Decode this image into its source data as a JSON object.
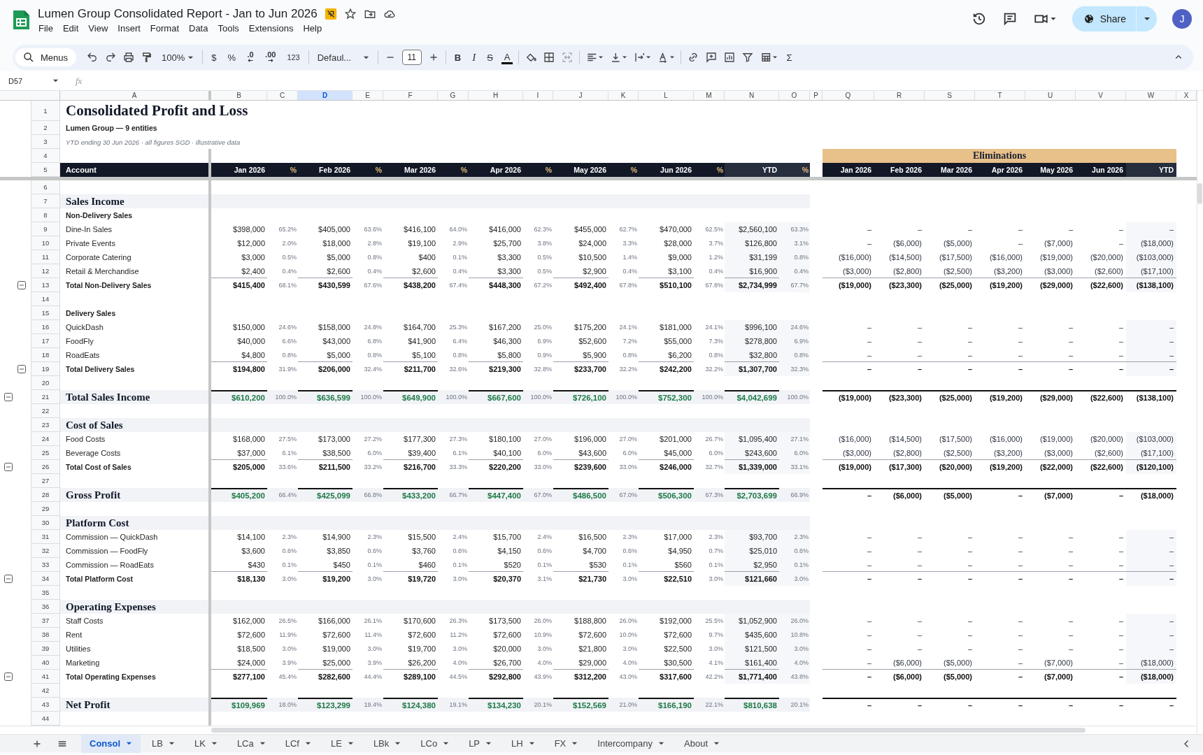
{
  "document": {
    "title": "Lumen Group Consolidated Report - Jan to Jun 2026",
    "menus": [
      "File",
      "Edit",
      "View",
      "Insert",
      "Format",
      "Data",
      "Tools",
      "Extensions",
      "Help"
    ],
    "share": "Share",
    "avatar": "J"
  },
  "toolbar": {
    "menus": "Menus",
    "zoom": "100%",
    "currency": "$",
    "percent": "%",
    "dec_less": ".0",
    "dec_more": ".00",
    "number_format": "123",
    "font": "Defaul...",
    "font_size": "11",
    "bold": "B",
    "italic": "I",
    "strikethrough": "S",
    "text_color": "A",
    "sum": "Σ"
  },
  "formula_bar": {
    "cell": "D57",
    "fx": "fx"
  },
  "columns": [
    {
      "letter": "A",
      "selected": false
    },
    {
      "letter": "B",
      "selected": false
    },
    {
      "letter": "C",
      "selected": false
    },
    {
      "letter": "D",
      "selected": true
    },
    {
      "letter": "E",
      "selected": false
    },
    {
      "letter": "F",
      "selected": false
    },
    {
      "letter": "G",
      "selected": false
    },
    {
      "letter": "H",
      "selected": false
    },
    {
      "letter": "I",
      "selected": false
    },
    {
      "letter": "J",
      "selected": false
    },
    {
      "letter": "K",
      "selected": false
    },
    {
      "letter": "L",
      "selected": false
    },
    {
      "letter": "M",
      "selected": false
    },
    {
      "letter": "N",
      "selected": false
    },
    {
      "letter": "O",
      "selected": false
    },
    {
      "letter": "P",
      "selected": false
    },
    {
      "letter": "Q",
      "selected": false
    },
    {
      "letter": "R",
      "selected": false
    },
    {
      "letter": "S",
      "selected": false
    },
    {
      "letter": "T",
      "selected": false
    },
    {
      "letter": "U",
      "selected": false
    },
    {
      "letter": "V",
      "selected": false
    },
    {
      "letter": "W",
      "selected": false
    },
    {
      "letter": "X",
      "selected": false
    }
  ],
  "rows": [
    {
      "number": "1",
      "kind": "title",
      "label": "Consolidated Profit and Loss"
    },
    {
      "number": "2",
      "kind": "subtitle",
      "label": "Lumen Group — 9 entities"
    },
    {
      "number": "3",
      "kind": "note",
      "label": "YTD ending 30 Jun 2026  ·  all figures SGD  ·  illustrative data"
    },
    {
      "number": "4",
      "kind": "blank",
      "elim_title": "Eliminations"
    },
    {
      "number": "5",
      "kind": "header",
      "label": "Account",
      "values": [
        "Jan 2026",
        "%",
        "Feb 2026",
        "%",
        "Mar 2026",
        "%",
        "Apr 2026",
        "%",
        "May 2026",
        "%",
        "Jun 2026",
        "%",
        "YTD",
        "%"
      ],
      "elim": [
        "Jan 2026",
        "Feb 2026",
        "Mar 2026",
        "Apr 2026",
        "May 2026",
        "Jun 2026",
        "YTD"
      ]
    },
    {
      "number": "6",
      "kind": "blank"
    },
    {
      "number": "7",
      "kind": "section",
      "label": "Sales Income"
    },
    {
      "number": "8",
      "kind": "subhead",
      "label": "Non-Delivery Sales"
    },
    {
      "number": "9",
      "kind": "item",
      "label": "Dine-In Sales",
      "values": [
        "$398,000",
        "65.2%",
        "$405,000",
        "63.6%",
        "$416,100",
        "64.0%",
        "$416,000",
        "62.3%",
        "$455,000",
        "62.7%",
        "$470,000",
        "62.5%",
        "$2,560,100",
        "63.3%"
      ],
      "elim": [
        "–",
        "–",
        "–",
        "–",
        "–",
        "–",
        "–"
      ]
    },
    {
      "number": "10",
      "kind": "item",
      "label": "Private Events",
      "values": [
        "$12,000",
        "2.0%",
        "$18,000",
        "2.8%",
        "$19,100",
        "2.9%",
        "$25,700",
        "3.8%",
        "$24,000",
        "3.3%",
        "$28,000",
        "3.7%",
        "$126,800",
        "3.1%"
      ],
      "elim": [
        "–",
        "($6,000)",
        "($5,000)",
        "–",
        "($7,000)",
        "–",
        "($18,000)"
      ]
    },
    {
      "number": "11",
      "kind": "item",
      "label": "Corporate Catering",
      "values": [
        "$3,000",
        "0.5%",
        "$5,000",
        "0.8%",
        "$400",
        "0.1%",
        "$3,300",
        "0.5%",
        "$10,500",
        "1.4%",
        "$9,000",
        "1.2%",
        "$31,199",
        "0.8%"
      ],
      "elim": [
        "($16,000)",
        "($14,500)",
        "($17,500)",
        "($16,000)",
        "($19,000)",
        "($20,000)",
        "($103,000)"
      ]
    },
    {
      "number": "12",
      "kind": "item",
      "label": "Retail & Merchandise",
      "values": [
        "$2,400",
        "0.4%",
        "$2,600",
        "0.4%",
        "$2,600",
        "0.4%",
        "$3,300",
        "0.5%",
        "$2,900",
        "0.4%",
        "$3,100",
        "0.4%",
        "$16,900",
        "0.4%"
      ],
      "elim": [
        "($3,000)",
        "($2,800)",
        "($2,500)",
        "($3,200)",
        "($3,000)",
        "($2,600)",
        "($17,100)"
      ]
    },
    {
      "number": "13",
      "kind": "total",
      "collapsed": false,
      "label": "Total Non-Delivery Sales",
      "values": [
        "$415,400",
        "68.1%",
        "$430,599",
        "67.6%",
        "$438,200",
        "67.4%",
        "$448,300",
        "67.2%",
        "$492,400",
        "67.8%",
        "$510,100",
        "67.8%",
        "$2,734,999",
        "67.7%"
      ],
      "elim": [
        "($19,000)",
        "($23,300)",
        "($25,000)",
        "($19,200)",
        "($29,000)",
        "($22,600)",
        "($138,100)"
      ]
    },
    {
      "number": "14",
      "kind": "blank"
    },
    {
      "number": "15",
      "kind": "subhead",
      "label": "Delivery Sales"
    },
    {
      "number": "16",
      "kind": "item",
      "label": "QuickDash",
      "values": [
        "$150,000",
        "24.6%",
        "$158,000",
        "24.8%",
        "$164,700",
        "25.3%",
        "$167,200",
        "25.0%",
        "$175,200",
        "24.1%",
        "$181,000",
        "24.1%",
        "$996,100",
        "24.6%"
      ],
      "elim": [
        "–",
        "–",
        "–",
        "–",
        "–",
        "–",
        "–"
      ]
    },
    {
      "number": "17",
      "kind": "item",
      "label": "FoodFly",
      "values": [
        "$40,000",
        "6.6%",
        "$43,000",
        "6.8%",
        "$41,900",
        "6.4%",
        "$46,300",
        "6.9%",
        "$52,600",
        "7.2%",
        "$55,000",
        "7.3%",
        "$278,800",
        "6.9%"
      ],
      "elim": [
        "–",
        "–",
        "–",
        "–",
        "–",
        "–",
        "–"
      ]
    },
    {
      "number": "18",
      "kind": "item",
      "label": "RoadEats",
      "values": [
        "$4,800",
        "0.8%",
        "$5,000",
        "0.8%",
        "$5,100",
        "0.8%",
        "$5,800",
        "0.9%",
        "$5,900",
        "0.8%",
        "$6,200",
        "0.8%",
        "$32,800",
        "0.8%"
      ],
      "elim": [
        "–",
        "–",
        "–",
        "–",
        "–",
        "–",
        "–"
      ]
    },
    {
      "number": "19",
      "kind": "total",
      "collapsed": false,
      "label": "Total Delivery Sales",
      "values": [
        "$194,800",
        "31.9%",
        "$206,000",
        "32.4%",
        "$211,700",
        "32.6%",
        "$219,300",
        "32.8%",
        "$233,700",
        "32.2%",
        "$242,200",
        "32.2%",
        "$1,307,700",
        "32.3%"
      ],
      "elim": [
        "–",
        "–",
        "–",
        "–",
        "–",
        "–",
        "–"
      ]
    },
    {
      "number": "20",
      "kind": "blank"
    },
    {
      "number": "21",
      "kind": "grand",
      "collapsed": false,
      "label": "Total Sales Income",
      "values": [
        "$610,200",
        "100.0%",
        "$636,599",
        "100.0%",
        "$649,900",
        "100.0%",
        "$667,600",
        "100.0%",
        "$726,100",
        "100.0%",
        "$752,300",
        "100.0%",
        "$4,042,699",
        "100.0%"
      ],
      "elim": [
        "($19,000)",
        "($23,300)",
        "($25,000)",
        "($19,200)",
        "($29,000)",
        "($22,600)",
        "($138,100)"
      ]
    },
    {
      "number": "22",
      "kind": "blank"
    },
    {
      "number": "23",
      "kind": "section",
      "label": "Cost of Sales"
    },
    {
      "number": "24",
      "kind": "item",
      "label": "Food Costs",
      "values": [
        "$168,000",
        "27.5%",
        "$173,000",
        "27.2%",
        "$177,300",
        "27.3%",
        "$180,100",
        "27.0%",
        "$196,000",
        "27.0%",
        "$201,000",
        "26.7%",
        "$1,095,400",
        "27.1%"
      ],
      "elim": [
        "($16,000)",
        "($14,500)",
        "($17,500)",
        "($16,000)",
        "($19,000)",
        "($20,000)",
        "($103,000)"
      ]
    },
    {
      "number": "25",
      "kind": "item",
      "label": "Beverage Costs",
      "values": [
        "$37,000",
        "6.1%",
        "$38,500",
        "6.0%",
        "$39,400",
        "6.1%",
        "$40,100",
        "6.0%",
        "$43,600",
        "6.0%",
        "$45,000",
        "6.0%",
        "$243,600",
        "6.0%"
      ],
      "elim": [
        "($3,000)",
        "($2,800)",
        "($2,500)",
        "($3,200)",
        "($3,000)",
        "($2,600)",
        "($17,100)"
      ]
    },
    {
      "number": "26",
      "kind": "total",
      "collapsed": false,
      "label": "Total Cost of Sales",
      "values": [
        "$205,000",
        "33.6%",
        "$211,500",
        "33.2%",
        "$216,700",
        "33.3%",
        "$220,200",
        "33.0%",
        "$239,600",
        "33.0%",
        "$246,000",
        "32.7%",
        "$1,339,000",
        "33.1%"
      ],
      "elim": [
        "($19,000)",
        "($17,300)",
        "($20,000)",
        "($19,200)",
        "($22,000)",
        "($22,600)",
        "($120,100)"
      ]
    },
    {
      "number": "27",
      "kind": "blank"
    },
    {
      "number": "28",
      "kind": "grand",
      "label": "Gross Profit",
      "values": [
        "$405,200",
        "66.4%",
        "$425,099",
        "66.8%",
        "$433,200",
        "66.7%",
        "$447,400",
        "67.0%",
        "$486,500",
        "67.0%",
        "$506,300",
        "67.3%",
        "$2,703,699",
        "66.9%"
      ],
      "elim": [
        "–",
        "($6,000)",
        "($5,000)",
        "–",
        "($7,000)",
        "–",
        "($18,000)"
      ]
    },
    {
      "number": "29",
      "kind": "blank"
    },
    {
      "number": "30",
      "kind": "section",
      "label": "Platform Cost"
    },
    {
      "number": "31",
      "kind": "item",
      "label": "Commission — QuickDash",
      "values": [
        "$14,100",
        "2.3%",
        "$14,900",
        "2.3%",
        "$15,500",
        "2.4%",
        "$15,700",
        "2.4%",
        "$16,500",
        "2.3%",
        "$17,000",
        "2.3%",
        "$93,700",
        "2.3%"
      ],
      "elim": [
        "–",
        "–",
        "–",
        "–",
        "–",
        "–",
        "–"
      ]
    },
    {
      "number": "32",
      "kind": "item",
      "label": "Commission — FoodFly",
      "values": [
        "$3,600",
        "0.6%",
        "$3,850",
        "0.6%",
        "$3,760",
        "0.6%",
        "$4,150",
        "0.6%",
        "$4,700",
        "0.6%",
        "$4,950",
        "0.7%",
        "$25,010",
        "0.6%"
      ],
      "elim": [
        "–",
        "–",
        "–",
        "–",
        "–",
        "–",
        "–"
      ]
    },
    {
      "number": "33",
      "kind": "item",
      "label": "Commission — RoadEats",
      "values": [
        "$430",
        "0.1%",
        "$450",
        "0.1%",
        "$460",
        "0.1%",
        "$520",
        "0.1%",
        "$530",
        "0.1%",
        "$560",
        "0.1%",
        "$2,950",
        "0.1%"
      ],
      "elim": [
        "–",
        "–",
        "–",
        "–",
        "–",
        "–",
        "–"
      ]
    },
    {
      "number": "34",
      "kind": "total",
      "collapsed": false,
      "label": "Total Platform Cost",
      "values": [
        "$18,130",
        "3.0%",
        "$19,200",
        "3.0%",
        "$19,720",
        "3.0%",
        "$20,370",
        "3.1%",
        "$21,730",
        "3.0%",
        "$22,510",
        "3.0%",
        "$121,660",
        "3.0%"
      ],
      "elim": [
        "–",
        "–",
        "–",
        "–",
        "–",
        "–",
        "–"
      ]
    },
    {
      "number": "35",
      "kind": "blank"
    },
    {
      "number": "36",
      "kind": "section",
      "label": "Operating Expenses"
    },
    {
      "number": "37",
      "kind": "item",
      "label": "Staff Costs",
      "values": [
        "$162,000",
        "26.5%",
        "$166,000",
        "26.1%",
        "$170,600",
        "26.3%",
        "$173,500",
        "26.0%",
        "$188,800",
        "26.0%",
        "$192,000",
        "25.5%",
        "$1,052,900",
        "26.0%"
      ],
      "elim": [
        "–",
        "–",
        "–",
        "–",
        "–",
        "–",
        "–"
      ]
    },
    {
      "number": "38",
      "kind": "item",
      "label": "Rent",
      "values": [
        "$72,600",
        "11.9%",
        "$72,600",
        "11.4%",
        "$72,600",
        "11.2%",
        "$72,600",
        "10.9%",
        "$72,600",
        "10.0%",
        "$72,600",
        "9.7%",
        "$435,600",
        "10.8%"
      ],
      "elim": [
        "–",
        "–",
        "–",
        "–",
        "–",
        "–",
        "–"
      ]
    },
    {
      "number": "39",
      "kind": "item",
      "label": "Utilities",
      "values": [
        "$18,500",
        "3.0%",
        "$19,000",
        "3.0%",
        "$19,700",
        "3.0%",
        "$20,000",
        "3.0%",
        "$21,800",
        "3.0%",
        "$22,500",
        "3.0%",
        "$121,500",
        "3.0%"
      ],
      "elim": [
        "–",
        "–",
        "–",
        "–",
        "–",
        "–",
        "–"
      ]
    },
    {
      "number": "40",
      "kind": "item",
      "label": "Marketing",
      "values": [
        "$24,000",
        "3.9%",
        "$25,000",
        "3.9%",
        "$26,200",
        "4.0%",
        "$26,700",
        "4.0%",
        "$29,000",
        "4.0%",
        "$30,500",
        "4.1%",
        "$161,400",
        "4.0%"
      ],
      "elim": [
        "–",
        "($6,000)",
        "($5,000)",
        "–",
        "($7,000)",
        "–",
        "($18,000)"
      ]
    },
    {
      "number": "41",
      "kind": "total",
      "collapsed": false,
      "label": "Total Operating Expenses",
      "values": [
        "$277,100",
        "45.4%",
        "$282,600",
        "44.4%",
        "$289,100",
        "44.5%",
        "$292,800",
        "43.9%",
        "$312,200",
        "43.0%",
        "$317,600",
        "42.2%",
        "$1,771,400",
        "43.8%"
      ],
      "elim": [
        "–",
        "($6,000)",
        "($5,000)",
        "–",
        "($7,000)",
        "–",
        "($18,000)"
      ]
    },
    {
      "number": "42",
      "kind": "blank"
    },
    {
      "number": "43",
      "kind": "grand",
      "label": "Net Profit",
      "values": [
        "$109,969",
        "18.0%",
        "$123,299",
        "19.4%",
        "$124,380",
        "19.1%",
        "$134,230",
        "20.1%",
        "$152,569",
        "21.0%",
        "$166,190",
        "22.1%",
        "$810,638",
        "20.1%"
      ],
      "elim": [
        "–",
        "–",
        "–",
        "–",
        "–",
        "–",
        "–"
      ]
    },
    {
      "number": "44",
      "kind": "blank"
    }
  ],
  "sheet_tabs": [
    {
      "label": "Consol",
      "selected": true
    },
    {
      "label": "LB",
      "selected": false
    },
    {
      "label": "LK",
      "selected": false
    },
    {
      "label": "LCa",
      "selected": false
    },
    {
      "label": "LCf",
      "selected": false
    },
    {
      "label": "LE",
      "selected": false
    },
    {
      "label": "LBk",
      "selected": false
    },
    {
      "label": "LCo",
      "selected": false
    },
    {
      "label": "LP",
      "selected": false
    },
    {
      "label": "LH",
      "selected": false
    },
    {
      "label": "FX",
      "selected": false
    },
    {
      "label": "Intercompany",
      "selected": false
    },
    {
      "label": "About",
      "selected": false
    }
  ]
}
